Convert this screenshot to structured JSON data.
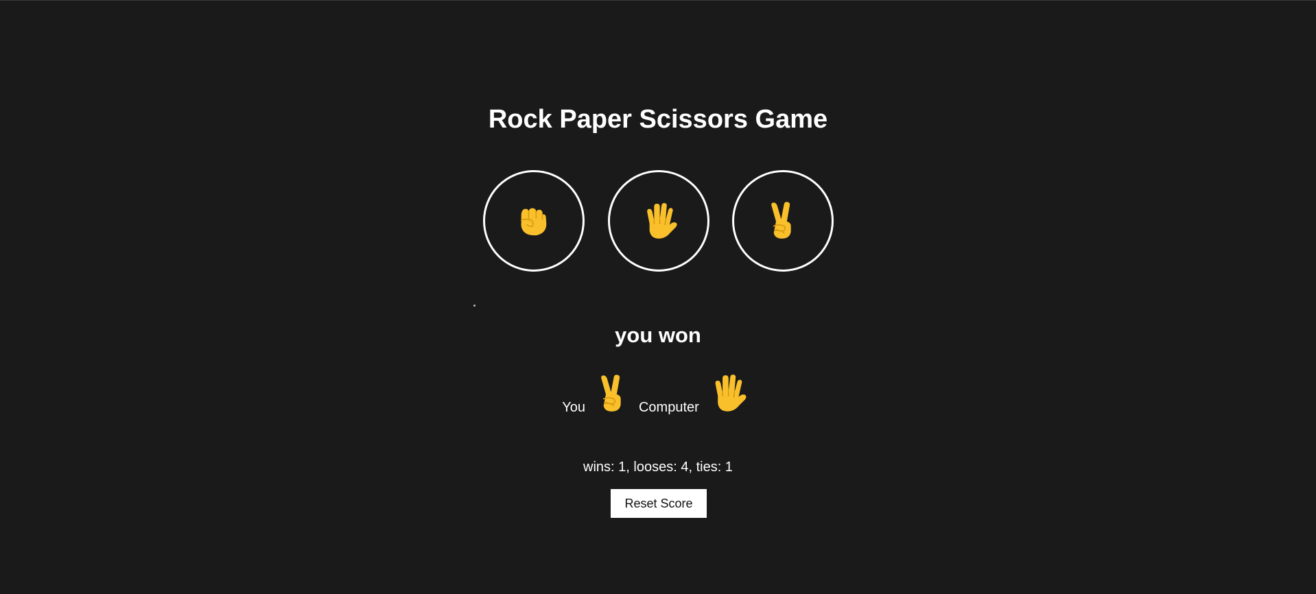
{
  "game": {
    "title": "Rock Paper Scissors Game"
  },
  "moves": [
    {
      "name": "rock",
      "icon": "raised-fist-icon"
    },
    {
      "name": "paper",
      "icon": "raised-hand-icon"
    },
    {
      "name": "scissors",
      "icon": "victory-hand-icon"
    }
  ],
  "result": {
    "text": "you won"
  },
  "picks": {
    "you_label": "You",
    "you_icon": "victory-hand-icon",
    "computer_label": "Computer",
    "computer_icon": "raised-hand-icon"
  },
  "score": {
    "text": "wins: 1, looses: 4, ties: 1"
  },
  "controls": {
    "reset_label": "Reset Score"
  },
  "colors": {
    "background": "#1a1a1a",
    "text": "#ffffff",
    "emoji": "#f9c02b",
    "button_bg": "#ffffff"
  }
}
